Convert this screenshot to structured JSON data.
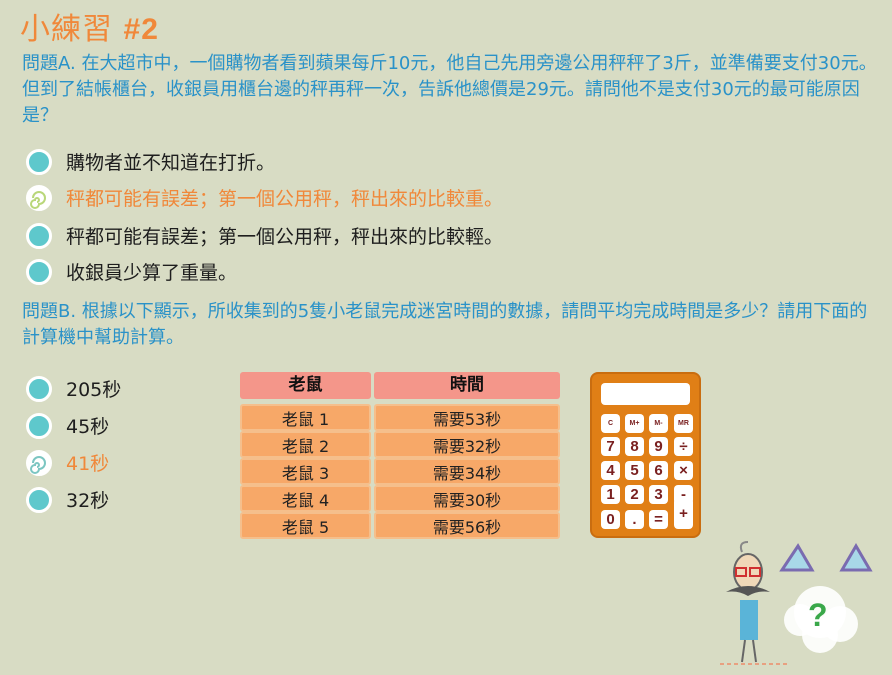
{
  "title": {
    "prefix": "小練習 ",
    "number": "#2"
  },
  "question_a": {
    "text": "問題A. 在大超市中，一個購物者看到蘋果每斤10元，他自己先用旁邊公用秤秤了3斤，並準備要支付30元。但到了結帳櫃台，收銀員用櫃台邊的秤再秤一次，告訴他總價是29元。請問他不是支付30元的最可能原因是？",
    "options": [
      {
        "label": "購物者並不知道在打折。",
        "selected": false
      },
      {
        "label": "秤都可能有誤差；第一個公用秤，秤出來的比較重。",
        "selected": true
      },
      {
        "label": "秤都可能有誤差；第一個公用秤，秤出來的比較輕。",
        "selected": false
      },
      {
        "label": "收銀員少算了重量。",
        "selected": false
      }
    ]
  },
  "question_b": {
    "text": "問題B. 根據以下顯示，所收集到的5隻小老鼠完成迷宮時間的數據，請問平均完成時間是多少？請用下面的計算機中幫助計算。",
    "options": [
      {
        "label": "205秒",
        "selected": false
      },
      {
        "label": "45秒",
        "selected": false
      },
      {
        "label": "41秒",
        "selected": true
      },
      {
        "label": "32秒",
        "selected": false
      }
    ]
  },
  "table": {
    "headers": [
      "老鼠",
      "時間"
    ],
    "rows": [
      [
        "老鼠 1",
        "需要53秒"
      ],
      [
        "老鼠 2",
        "需要32秒"
      ],
      [
        "老鼠 3",
        "需要34秒"
      ],
      [
        "老鼠 4",
        "需要30秒"
      ],
      [
        "老鼠 5",
        "需要56秒"
      ]
    ]
  },
  "calculator": {
    "top_keys": [
      "C",
      "M+",
      "M-",
      "MR"
    ],
    "digit_rows": [
      [
        "7",
        "8",
        "9"
      ],
      [
        "4",
        "5",
        "6"
      ],
      [
        "1",
        "2",
        "3"
      ],
      [
        "0",
        ".",
        "="
      ]
    ],
    "ops": [
      "÷",
      "×",
      "-",
      "+"
    ]
  },
  "colors": {
    "accent": "#f0883a",
    "question": "#2a92c8",
    "radio": "#5ec8cc",
    "background": "#d8dcc4"
  }
}
